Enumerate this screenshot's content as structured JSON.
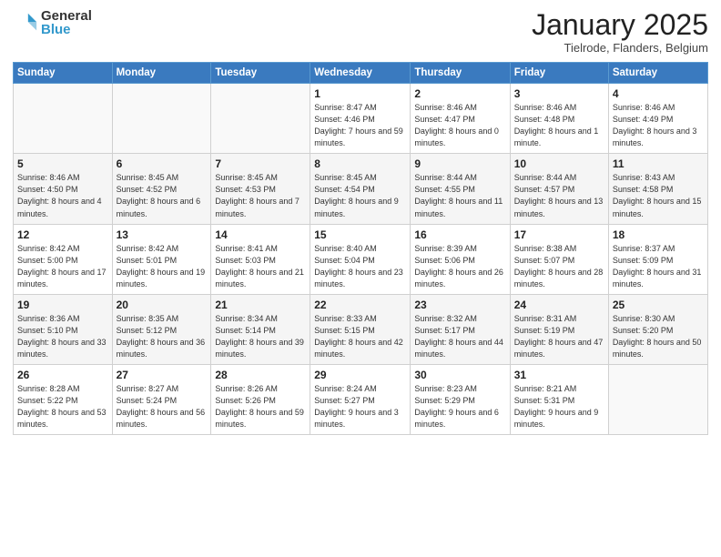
{
  "header": {
    "logo_general": "General",
    "logo_blue": "Blue",
    "title": "January 2025",
    "subtitle": "Tielrode, Flanders, Belgium"
  },
  "weekdays": [
    "Sunday",
    "Monday",
    "Tuesday",
    "Wednesday",
    "Thursday",
    "Friday",
    "Saturday"
  ],
  "weeks": [
    [
      {
        "day": "",
        "info": ""
      },
      {
        "day": "",
        "info": ""
      },
      {
        "day": "",
        "info": ""
      },
      {
        "day": "1",
        "info": "Sunrise: 8:47 AM\nSunset: 4:46 PM\nDaylight: 7 hours and 59 minutes."
      },
      {
        "day": "2",
        "info": "Sunrise: 8:46 AM\nSunset: 4:47 PM\nDaylight: 8 hours and 0 minutes."
      },
      {
        "day": "3",
        "info": "Sunrise: 8:46 AM\nSunset: 4:48 PM\nDaylight: 8 hours and 1 minute."
      },
      {
        "day": "4",
        "info": "Sunrise: 8:46 AM\nSunset: 4:49 PM\nDaylight: 8 hours and 3 minutes."
      }
    ],
    [
      {
        "day": "5",
        "info": "Sunrise: 8:46 AM\nSunset: 4:50 PM\nDaylight: 8 hours and 4 minutes."
      },
      {
        "day": "6",
        "info": "Sunrise: 8:45 AM\nSunset: 4:52 PM\nDaylight: 8 hours and 6 minutes."
      },
      {
        "day": "7",
        "info": "Sunrise: 8:45 AM\nSunset: 4:53 PM\nDaylight: 8 hours and 7 minutes."
      },
      {
        "day": "8",
        "info": "Sunrise: 8:45 AM\nSunset: 4:54 PM\nDaylight: 8 hours and 9 minutes."
      },
      {
        "day": "9",
        "info": "Sunrise: 8:44 AM\nSunset: 4:55 PM\nDaylight: 8 hours and 11 minutes."
      },
      {
        "day": "10",
        "info": "Sunrise: 8:44 AM\nSunset: 4:57 PM\nDaylight: 8 hours and 13 minutes."
      },
      {
        "day": "11",
        "info": "Sunrise: 8:43 AM\nSunset: 4:58 PM\nDaylight: 8 hours and 15 minutes."
      }
    ],
    [
      {
        "day": "12",
        "info": "Sunrise: 8:42 AM\nSunset: 5:00 PM\nDaylight: 8 hours and 17 minutes."
      },
      {
        "day": "13",
        "info": "Sunrise: 8:42 AM\nSunset: 5:01 PM\nDaylight: 8 hours and 19 minutes."
      },
      {
        "day": "14",
        "info": "Sunrise: 8:41 AM\nSunset: 5:03 PM\nDaylight: 8 hours and 21 minutes."
      },
      {
        "day": "15",
        "info": "Sunrise: 8:40 AM\nSunset: 5:04 PM\nDaylight: 8 hours and 23 minutes."
      },
      {
        "day": "16",
        "info": "Sunrise: 8:39 AM\nSunset: 5:06 PM\nDaylight: 8 hours and 26 minutes."
      },
      {
        "day": "17",
        "info": "Sunrise: 8:38 AM\nSunset: 5:07 PM\nDaylight: 8 hours and 28 minutes."
      },
      {
        "day": "18",
        "info": "Sunrise: 8:37 AM\nSunset: 5:09 PM\nDaylight: 8 hours and 31 minutes."
      }
    ],
    [
      {
        "day": "19",
        "info": "Sunrise: 8:36 AM\nSunset: 5:10 PM\nDaylight: 8 hours and 33 minutes."
      },
      {
        "day": "20",
        "info": "Sunrise: 8:35 AM\nSunset: 5:12 PM\nDaylight: 8 hours and 36 minutes."
      },
      {
        "day": "21",
        "info": "Sunrise: 8:34 AM\nSunset: 5:14 PM\nDaylight: 8 hours and 39 minutes."
      },
      {
        "day": "22",
        "info": "Sunrise: 8:33 AM\nSunset: 5:15 PM\nDaylight: 8 hours and 42 minutes."
      },
      {
        "day": "23",
        "info": "Sunrise: 8:32 AM\nSunset: 5:17 PM\nDaylight: 8 hours and 44 minutes."
      },
      {
        "day": "24",
        "info": "Sunrise: 8:31 AM\nSunset: 5:19 PM\nDaylight: 8 hours and 47 minutes."
      },
      {
        "day": "25",
        "info": "Sunrise: 8:30 AM\nSunset: 5:20 PM\nDaylight: 8 hours and 50 minutes."
      }
    ],
    [
      {
        "day": "26",
        "info": "Sunrise: 8:28 AM\nSunset: 5:22 PM\nDaylight: 8 hours and 53 minutes."
      },
      {
        "day": "27",
        "info": "Sunrise: 8:27 AM\nSunset: 5:24 PM\nDaylight: 8 hours and 56 minutes."
      },
      {
        "day": "28",
        "info": "Sunrise: 8:26 AM\nSunset: 5:26 PM\nDaylight: 8 hours and 59 minutes."
      },
      {
        "day": "29",
        "info": "Sunrise: 8:24 AM\nSunset: 5:27 PM\nDaylight: 9 hours and 3 minutes."
      },
      {
        "day": "30",
        "info": "Sunrise: 8:23 AM\nSunset: 5:29 PM\nDaylight: 9 hours and 6 minutes."
      },
      {
        "day": "31",
        "info": "Sunrise: 8:21 AM\nSunset: 5:31 PM\nDaylight: 9 hours and 9 minutes."
      },
      {
        "day": "",
        "info": ""
      }
    ]
  ]
}
